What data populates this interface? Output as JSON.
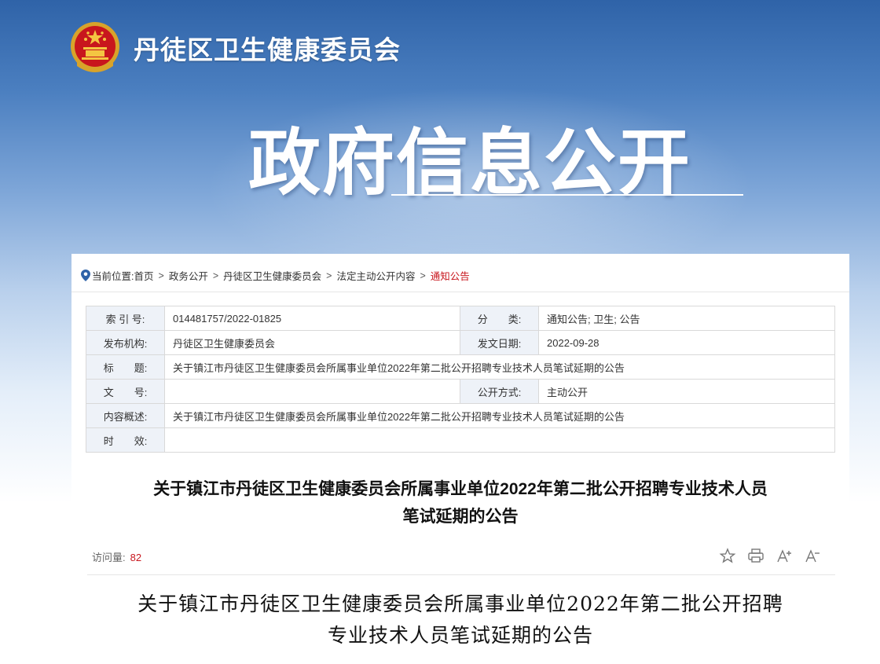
{
  "header": {
    "site_title": "丹徒区卫生健康委员会",
    "banner_title": "政府信息公开"
  },
  "breadcrumb": {
    "prefix": "当前位置:",
    "items": [
      "首页",
      "政务公开",
      "丹徒区卫生健康委员会",
      "法定主动公开内容",
      "通知公告"
    ],
    "separator": ">"
  },
  "meta": {
    "index_label": "索 引 号:",
    "index_value": "014481757/2022-01825",
    "category_label": "分　　类:",
    "category_value": "通知公告;  卫生;  公告",
    "issuer_label": "发布机构:",
    "issuer_value": "丹徒区卫生健康委员会",
    "date_label": "发文日期:",
    "date_value": "2022-09-28",
    "title_label": "标　　题:",
    "title_value": "关于镇江市丹徒区卫生健康委员会所属事业单位2022年第二批公开招聘专业技术人员笔试延期的公告",
    "docno_label": "文　　号:",
    "docno_value": "",
    "method_label": "公开方式:",
    "method_value": "主动公开",
    "summary_label": "内容概述:",
    "summary_value": "关于镇江市丹徒区卫生健康委员会所属事业单位2022年第二批公开招聘专业技术人员笔试延期的公告",
    "validity_label": "时　　效:",
    "validity_value": ""
  },
  "article": {
    "title_line1": "关于镇江市丹徒区卫生健康委员会所属事业单位2022年第二批公开招聘专业技术人员",
    "title_line2": "笔试延期的公告",
    "visits_label": "访问量:",
    "visits_count": "82",
    "body_title_line1": "关于镇江市丹徒区卫生健康委员会所属事业单位2022年第二批公开招聘",
    "body_title_line2": "专业技术人员笔试延期的公告"
  },
  "icons": [
    "emblem-icon",
    "location-pin-icon",
    "star-icon",
    "print-icon",
    "font-increase-icon",
    "font-decrease-icon"
  ],
  "colors": {
    "accent_red": "#c8161d",
    "header_blue": "#2f63a8",
    "label_bg": "#eef2f8"
  }
}
